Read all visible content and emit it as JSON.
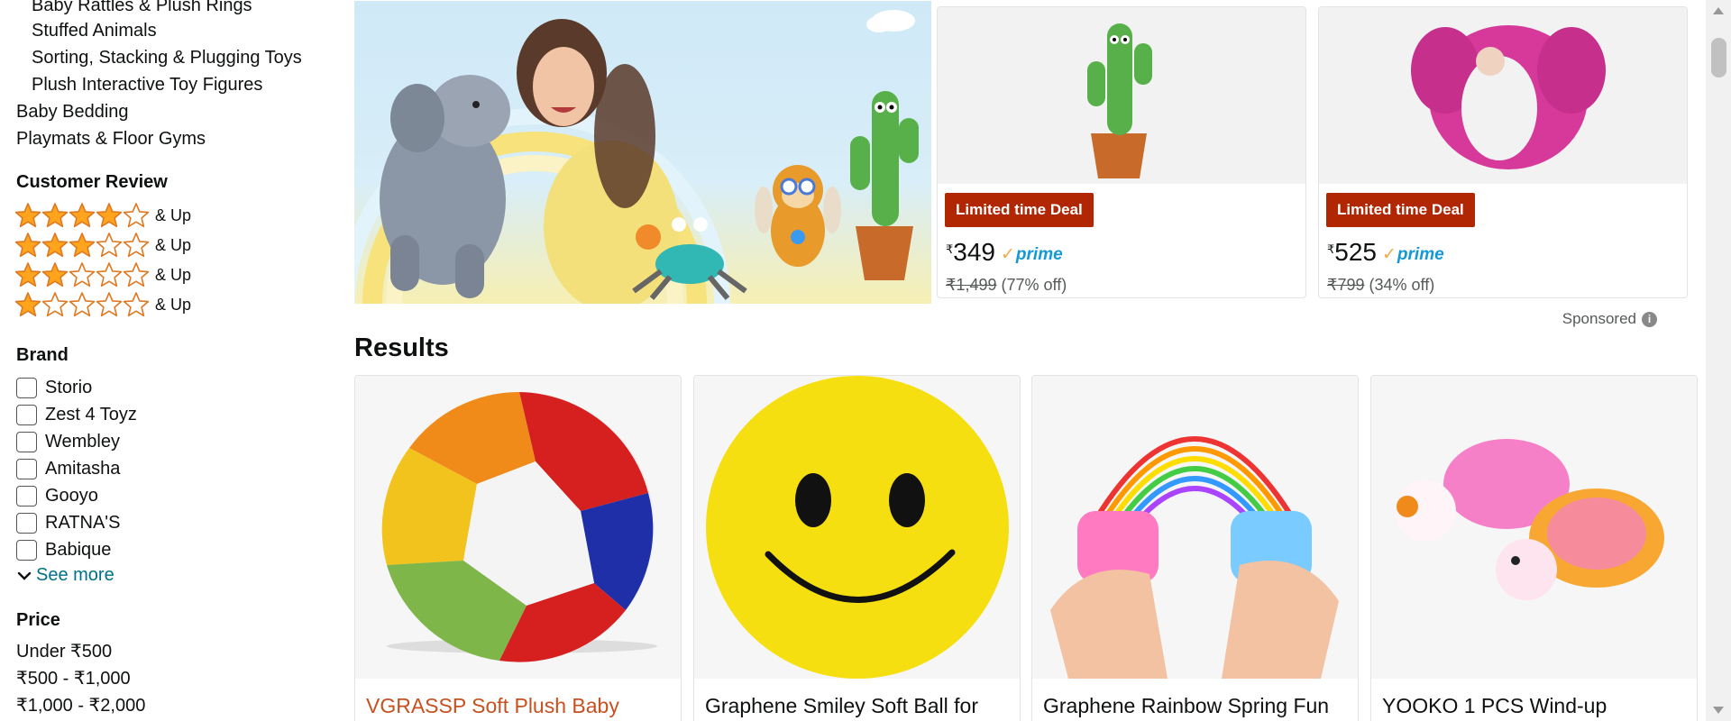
{
  "sidebar": {
    "categories_sub": [
      "Baby Rattles & Plush Rings",
      "Stuffed Animals",
      "Sorting, Stacking & Plugging Toys",
      "Plush Interactive Toy Figures"
    ],
    "categories_top": [
      "Baby Bedding",
      "Playmats & Floor Gyms"
    ],
    "review_heading": "Customer Review",
    "reviews": [
      {
        "stars": 4,
        "label": "& Up"
      },
      {
        "stars": 3,
        "label": "& Up"
      },
      {
        "stars": 2,
        "label": "& Up"
      },
      {
        "stars": 1,
        "label": "& Up"
      }
    ],
    "brand_heading": "Brand",
    "brands": [
      "Storio",
      "Zest 4 Toyz",
      "Wembley",
      "Amitasha",
      "Gooyo",
      "RATNA'S",
      "Babique"
    ],
    "see_more": "See more",
    "price_heading": "Price",
    "prices": [
      "Under ₹500",
      "₹500 - ₹1,000",
      "₹1,000 - ₹2,000"
    ]
  },
  "banner": {
    "deals": [
      {
        "badge": "Limited time Deal",
        "currency": "₹",
        "price": "349",
        "prime": "prime",
        "mrp": "₹1,499",
        "discount": "(77% off)",
        "image_icon": "dancing-cactus-toy-icon"
      },
      {
        "badge": "Limited time Deal",
        "currency": "₹",
        "price": "525",
        "prime": "prime",
        "mrp": "₹799",
        "discount": "(34% off)",
        "image_icon": "pink-elephant-plush-icon"
      }
    ],
    "sponsored": "Sponsored",
    "info_glyph": "i"
  },
  "results": {
    "title": "Results",
    "products": [
      {
        "title": "VGRASSP Soft Plush Baby",
        "image_icon": "plush-ball-icon",
        "sponsored": true
      },
      {
        "title": "Graphene Smiley Soft Ball for",
        "image_icon": "smiley-ball-icon",
        "sponsored": false
      },
      {
        "title": "Graphene Rainbow Spring Fun",
        "image_icon": "rainbow-spring-icon",
        "sponsored": false
      },
      {
        "title": "YOOKO 1 PCS Wind-up",
        "image_icon": "wind-up-turtle-icon",
        "sponsored": false
      }
    ]
  },
  "colors": {
    "deal_badge": "#B12704",
    "link_teal": "#007185",
    "sponsored_title": "#C7511F",
    "star": "#FFA41C",
    "prime_blue": "#1399d6"
  }
}
